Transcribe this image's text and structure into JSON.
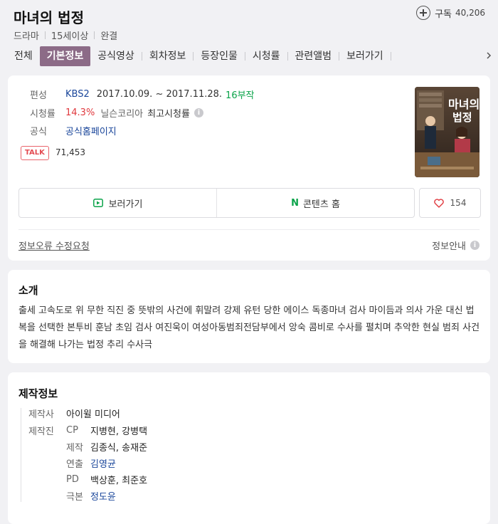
{
  "header": {
    "title": "마녀의 법정",
    "meta": [
      "드라마",
      "15세이상",
      "완결"
    ],
    "subscribe_label": "구독",
    "subscribe_count": "40,206"
  },
  "tabs": [
    {
      "label": "전체"
    },
    {
      "label": "기본정보"
    },
    {
      "label": "공식영상"
    },
    {
      "label": "회차정보"
    },
    {
      "label": "등장인물"
    },
    {
      "label": "시청률"
    },
    {
      "label": "관련앨범"
    },
    {
      "label": "보러가기"
    }
  ],
  "basic_info": {
    "broadcast": {
      "label": "편성",
      "channel": "KBS2",
      "period": "2017.10.09. ~ 2017.11.28.",
      "episodes": "16부작"
    },
    "rating": {
      "label": "시청률",
      "value": "14.3%",
      "source": "닐슨코리아",
      "note": "최고시청률"
    },
    "official": {
      "label": "공식",
      "link": "공식홈페이지"
    },
    "talk_badge": "TALK",
    "talk_count": "71,453",
    "watch_button": "보러가기",
    "content_home_button": "콘텐츠 홈",
    "content_home_logo": "N",
    "like_count": "154",
    "report_link": "정보오류 수정요청",
    "info_guide": "정보안내",
    "poster_title": "마녀의 법정",
    "colors": {
      "accent": "#8c6b87",
      "link": "#19459a",
      "green": "#0aa349",
      "red": "#e0393e"
    }
  },
  "intro": {
    "title": "소개",
    "text": "출세 고속도로 위 무한 직진 중 뜻밖의 사건에 휘말려 강제 유턴 당한 에이스 독종마녀 검사 마이듬과 의사 가운 대신 법복을 선택한 본투비 훈남 초임 검사 여진욱이 여성아동범죄전담부에서 앙숙 콤비로 수사를 펼치며 추악한 현실 범죄 사건을 해결해 나가는 법정 추리 수사극"
  },
  "production": {
    "title": "제작정보",
    "company_label": "제작사",
    "company": "아이윌 미디어",
    "staff_label": "제작진",
    "staff": [
      {
        "role": "CP",
        "names": "지병현, 강병택"
      },
      {
        "role": "제작",
        "names": "김종식, 송재준"
      },
      {
        "role": "연출",
        "names": "김영균"
      },
      {
        "role": "PD",
        "names": "백상훈, 최준호"
      },
      {
        "role": "극본",
        "names": "정도윤"
      }
    ]
  }
}
